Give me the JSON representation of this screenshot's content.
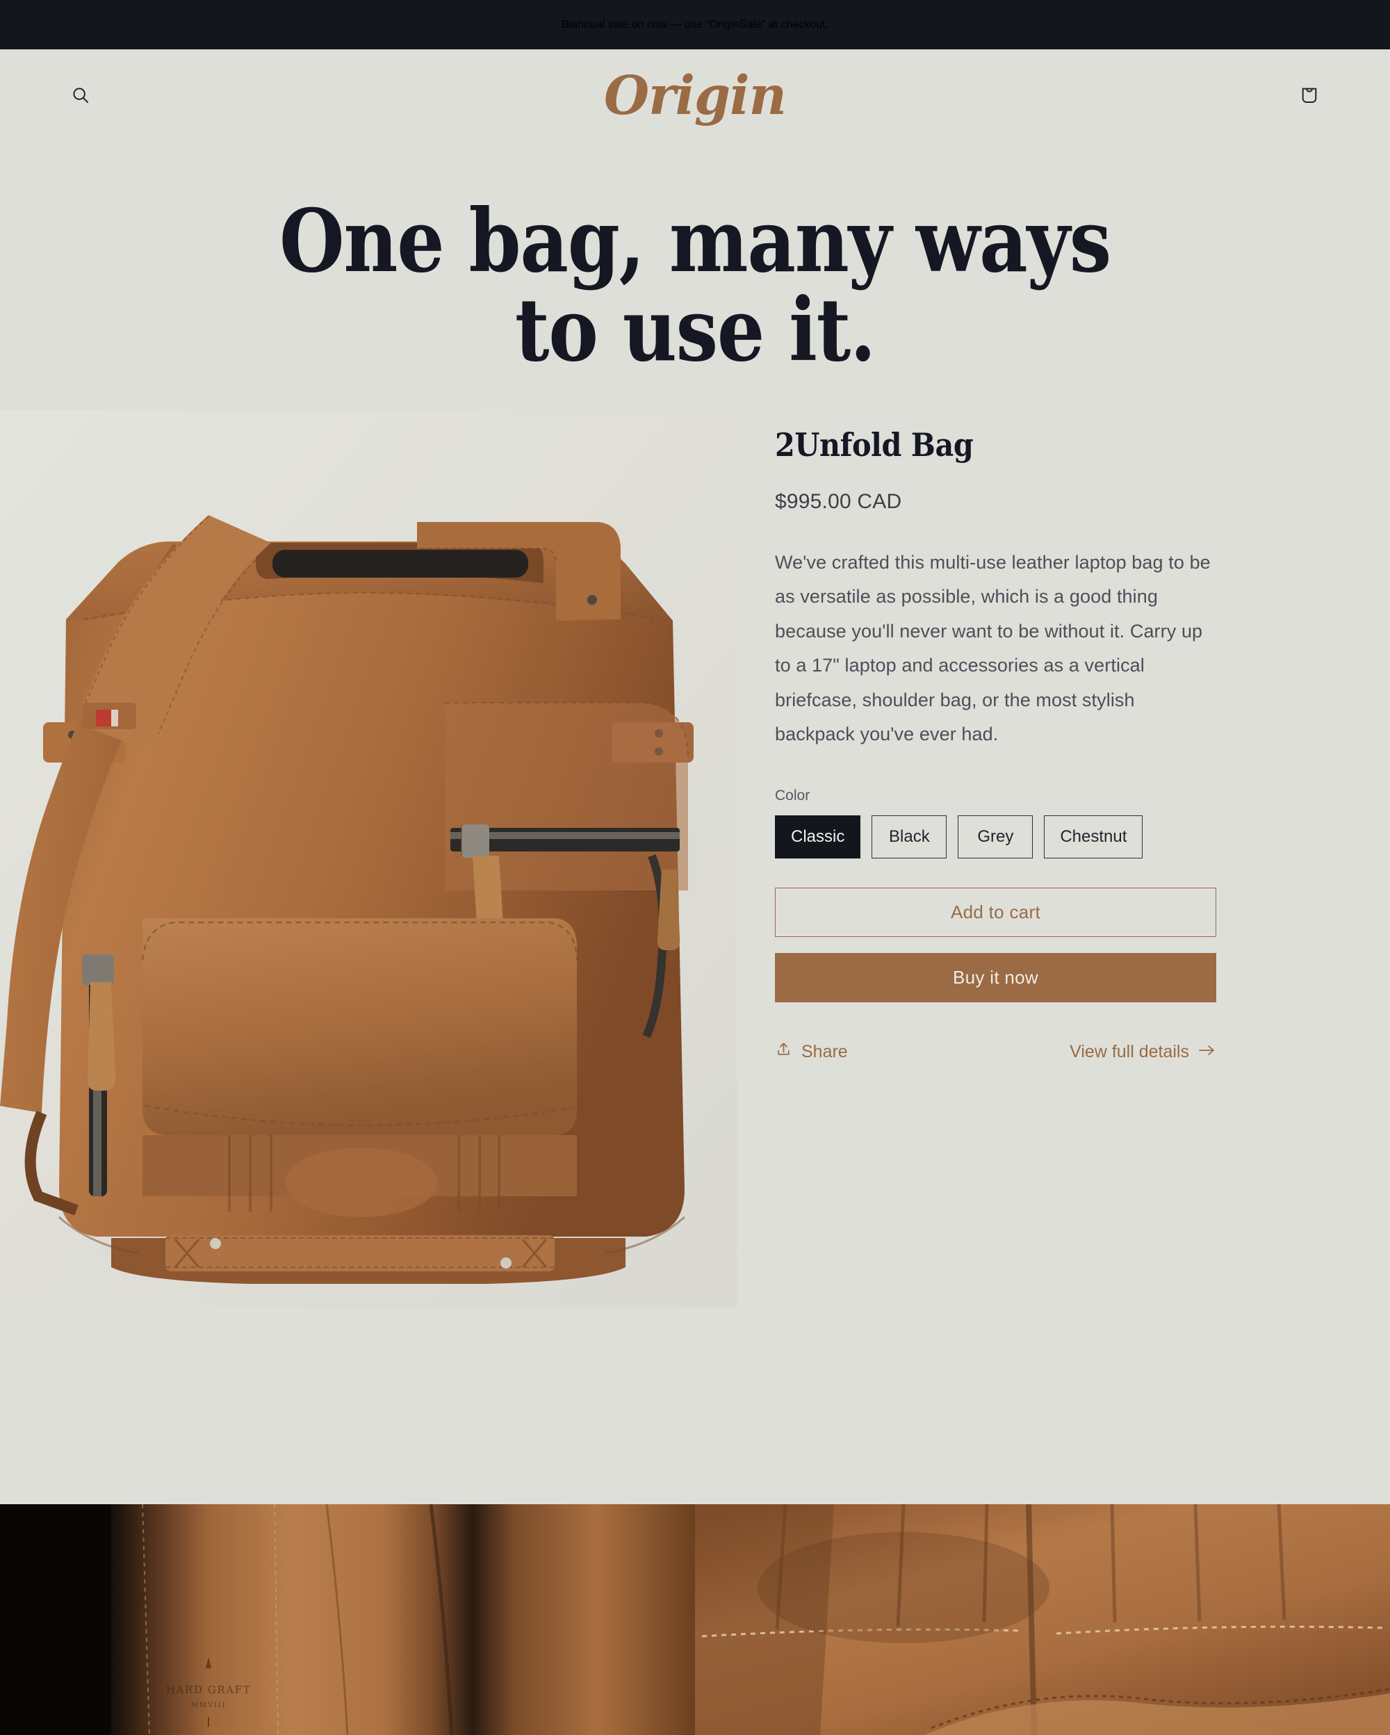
{
  "announcement": {
    "text": "Biannual sale on now — use \"OriginSale\" at checkout."
  },
  "header": {
    "logo": "Origin",
    "search_icon": "search-icon",
    "cart_icon": "shopping-bag-icon"
  },
  "hero": {
    "line1": "One bag, many ways",
    "line2": "to use it."
  },
  "product": {
    "title": "2Unfold Bag",
    "price": "$995.00 CAD",
    "description": "We've crafted this multi-use leather laptop bag to be as versatile as possible, which is a good thing because you'll never want to be without it. Carry up to a 17\" laptop and accessories as a vertical briefcase, shoulder bag, or the most stylish backpack you've ever had.",
    "option_label": "Color",
    "colors": [
      {
        "label": "Classic",
        "selected": true
      },
      {
        "label": "Black",
        "selected": false
      },
      {
        "label": "Grey",
        "selected": false
      },
      {
        "label": "Chestnut",
        "selected": false
      }
    ],
    "add_to_cart_label": "Add to cart",
    "buy_now_label": "Buy it now",
    "share_label": "Share",
    "details_label": "View full details",
    "details_arrow": "→",
    "image_alt": "tan-leather-laptop-bag-front-view"
  },
  "detail_images": {
    "left_alt": "leather-strap-closeup-with-embossed-brand",
    "left_emboss_brand": "HARD GRAFT",
    "left_emboss_year": "MMVIII",
    "right_alt": "leather-stitching-pleats-closeup"
  },
  "colors": {
    "page_bg": "#DEDFD9",
    "announcement_bg": "#14161E",
    "brand_brown": "#9A6B44",
    "ink": "#151823",
    "body_text": "#4B4F57"
  }
}
